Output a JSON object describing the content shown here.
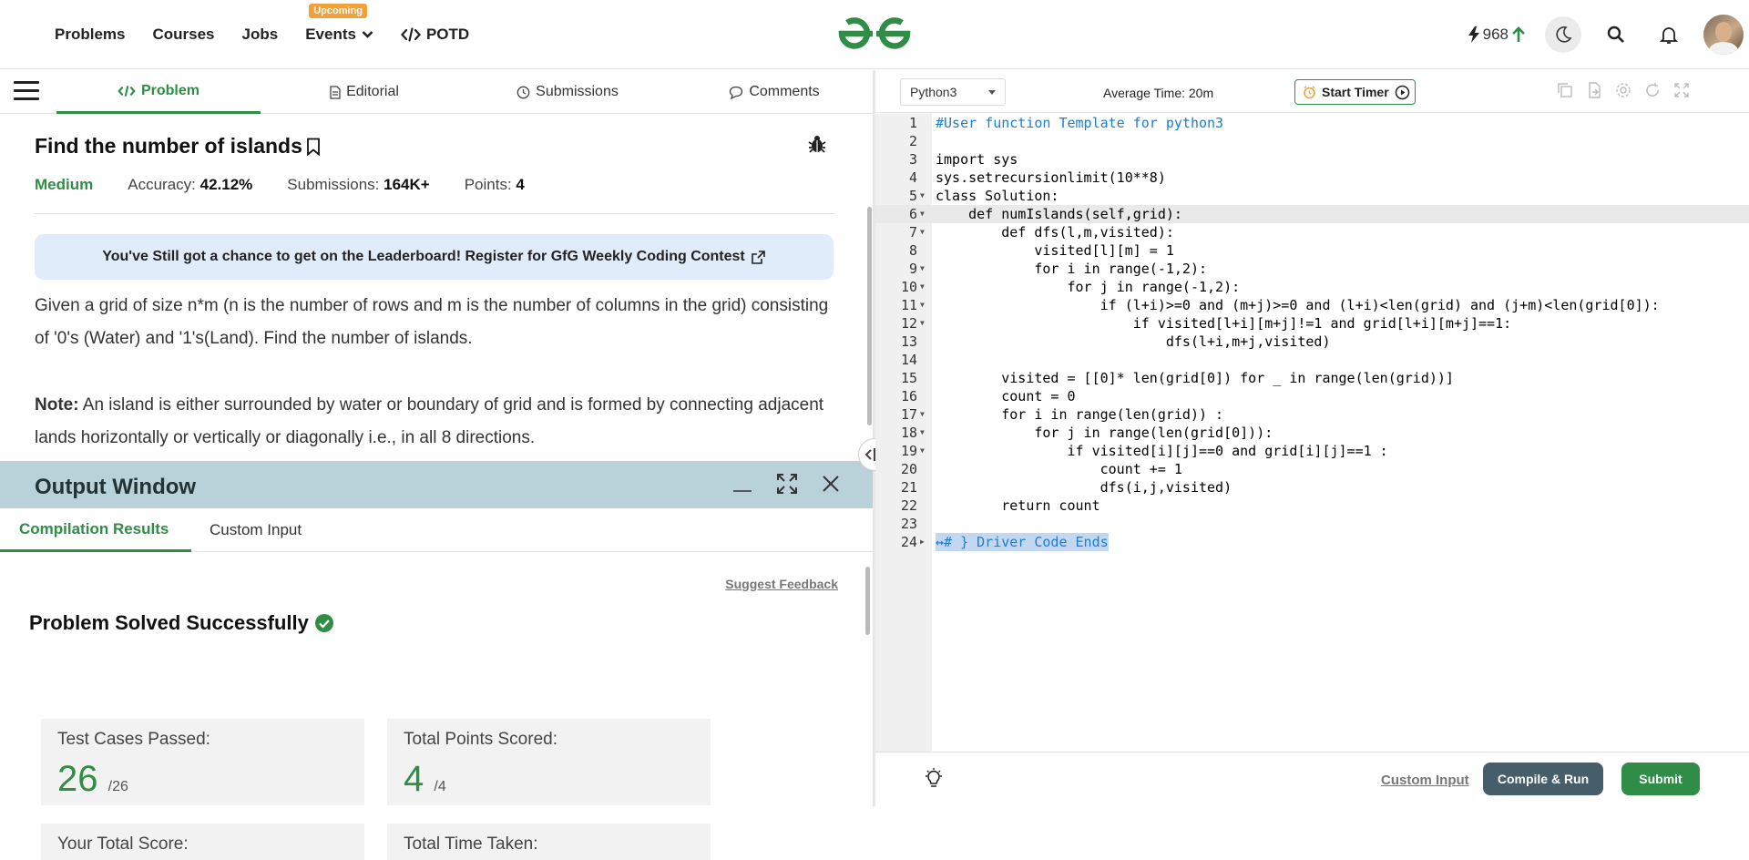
{
  "nav": {
    "links": [
      "Problems",
      "Courses",
      "Jobs",
      "Events",
      "POTD"
    ],
    "events_badge": "Upcoming",
    "streak": "968"
  },
  "problem_tabs": [
    "Problem",
    "Editorial",
    "Submissions",
    "Comments"
  ],
  "problem": {
    "title": "Find the number of islands",
    "difficulty": "Medium",
    "accuracy_label": "Accuracy:",
    "accuracy": "42.12%",
    "submissions_label": "Submissions:",
    "submissions": "164K+",
    "points_label": "Points:",
    "points": "4",
    "banner": "You've Still got a chance to get on the Leaderboard! Register for GfG Weekly Coding Contest",
    "description": "Given a grid of size n*m (n is the number of rows and m is the number of columns in the grid) consisting of '0's (Water) and '1's(Land). Find the number of islands.",
    "note_label": "Note:",
    "note": " An island is either surrounded by water or boundary of grid and is formed by connecting adjacent lands horizontally or vertically or diagonally i.e., in all 8 directions."
  },
  "output": {
    "title": "Output Window",
    "tabs": [
      "Compilation Results",
      "Custom Input"
    ],
    "suggest": "Suggest Feedback",
    "status": "Problem Solved Successfully",
    "cards": [
      {
        "label": "Test Cases Passed:",
        "value": "26",
        "total": "/26"
      },
      {
        "label": "Total Points Scored:",
        "value": "4",
        "total": "/4"
      },
      {
        "label": "Your Total Score:",
        "value": "",
        "total": ""
      },
      {
        "label": "Total Time Taken:",
        "value": "",
        "total": ""
      }
    ]
  },
  "editor": {
    "language": "Python3",
    "avg_time": "Average Time: 20m",
    "timer_label": "Start Timer",
    "lines": [
      {
        "n": "1",
        "text": "#User function Template for python3",
        "cls": "com"
      },
      {
        "n": "2",
        "text": ""
      },
      {
        "n": "3",
        "text": "import sys"
      },
      {
        "n": "4",
        "text": "sys.setrecursionlimit(10**8)"
      },
      {
        "n": "5",
        "text": "class Solution:",
        "fold": true
      },
      {
        "n": "6",
        "text": "    def numIslands(self,grid):",
        "fold": true,
        "hl": true
      },
      {
        "n": "7",
        "text": "        def dfs(l,m,visited):",
        "fold": true
      },
      {
        "n": "8",
        "text": "            visited[l][m] = 1"
      },
      {
        "n": "9",
        "text": "            for i in range(-1,2):",
        "fold": true
      },
      {
        "n": "10",
        "text": "                for j in range(-1,2):",
        "fold": true
      },
      {
        "n": "11",
        "text": "                    if (l+i)>=0 and (m+j)>=0 and (l+i)<len(grid) and (j+m)<len(grid[0]):",
        "fold": true
      },
      {
        "n": "12",
        "text": "                        if visited[l+i][m+j]!=1 and grid[l+i][m+j]==1:",
        "fold": true
      },
      {
        "n": "13",
        "text": "                            dfs(l+i,m+j,visited)"
      },
      {
        "n": "14",
        "text": ""
      },
      {
        "n": "15",
        "text": "        visited = [[0]* len(grid[0]) for _ in range(len(grid))]"
      },
      {
        "n": "16",
        "text": "        count = 0"
      },
      {
        "n": "17",
        "text": "        for i in range(len(grid)) :",
        "fold": true
      },
      {
        "n": "18",
        "text": "            for j in range(len(grid[0])):",
        "fold": true
      },
      {
        "n": "19",
        "text": "                if visited[i][j]==0 and grid[i][j]==1 :",
        "fold": true
      },
      {
        "n": "20",
        "text": "                    count += 1"
      },
      {
        "n": "21",
        "text": "                    dfs(i,j,visited)"
      },
      {
        "n": "22",
        "text": "        return count"
      },
      {
        "n": "23",
        "text": ""
      },
      {
        "n": "24",
        "text": "↔# } Driver Code Ends",
        "cls": "sel",
        "foldr": true
      }
    ],
    "custom_input": "Custom Input",
    "compile": "Compile & Run",
    "submit": "Submit"
  },
  "colors": {
    "brand_green": "#2f8d46",
    "output_header": "#b9d2da",
    "banner_bg": "#e1ecfb"
  }
}
